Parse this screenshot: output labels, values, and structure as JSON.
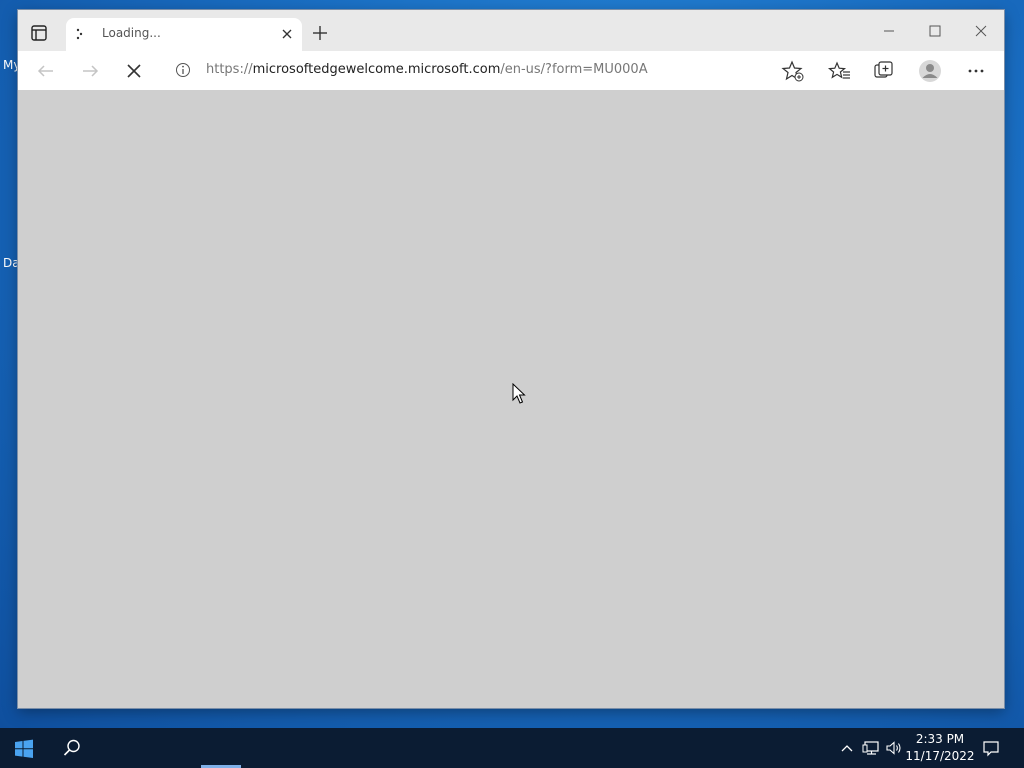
{
  "desktop": {
    "icon_labels": [
      "My",
      "Da"
    ]
  },
  "browser": {
    "tab": {
      "title": "Loading..."
    },
    "address": {
      "scheme": "https://",
      "host": "microsoftedgewelcome.microsoft.com",
      "path": "/en-us/?form=MU000A"
    },
    "icons": {
      "tab_actions": "tab-actions-icon",
      "spinner": "loading-spinner-icon",
      "new_tab": "plus-icon",
      "minimize": "minimize-icon",
      "maximize": "maximize-icon",
      "close": "close-icon",
      "back": "back-arrow-icon",
      "forward": "forward-arrow-icon",
      "stop": "stop-icon",
      "info": "info-icon",
      "add_favorite": "add-favorite-icon",
      "favorites": "favorites-icon",
      "collections": "collections-icon",
      "profile": "profile-icon",
      "menu": "more-icon"
    }
  },
  "taskbar": {
    "time": "2:33 PM",
    "date": "11/17/2022",
    "icons": [
      "start-icon",
      "search-icon",
      "chevron-up-icon",
      "network-icon",
      "volume-icon",
      "notification-icon"
    ]
  },
  "colors": {
    "desktop": "#1a6fc4",
    "taskbar": "#0b1c33",
    "content_loading": "#cfcfcf"
  }
}
